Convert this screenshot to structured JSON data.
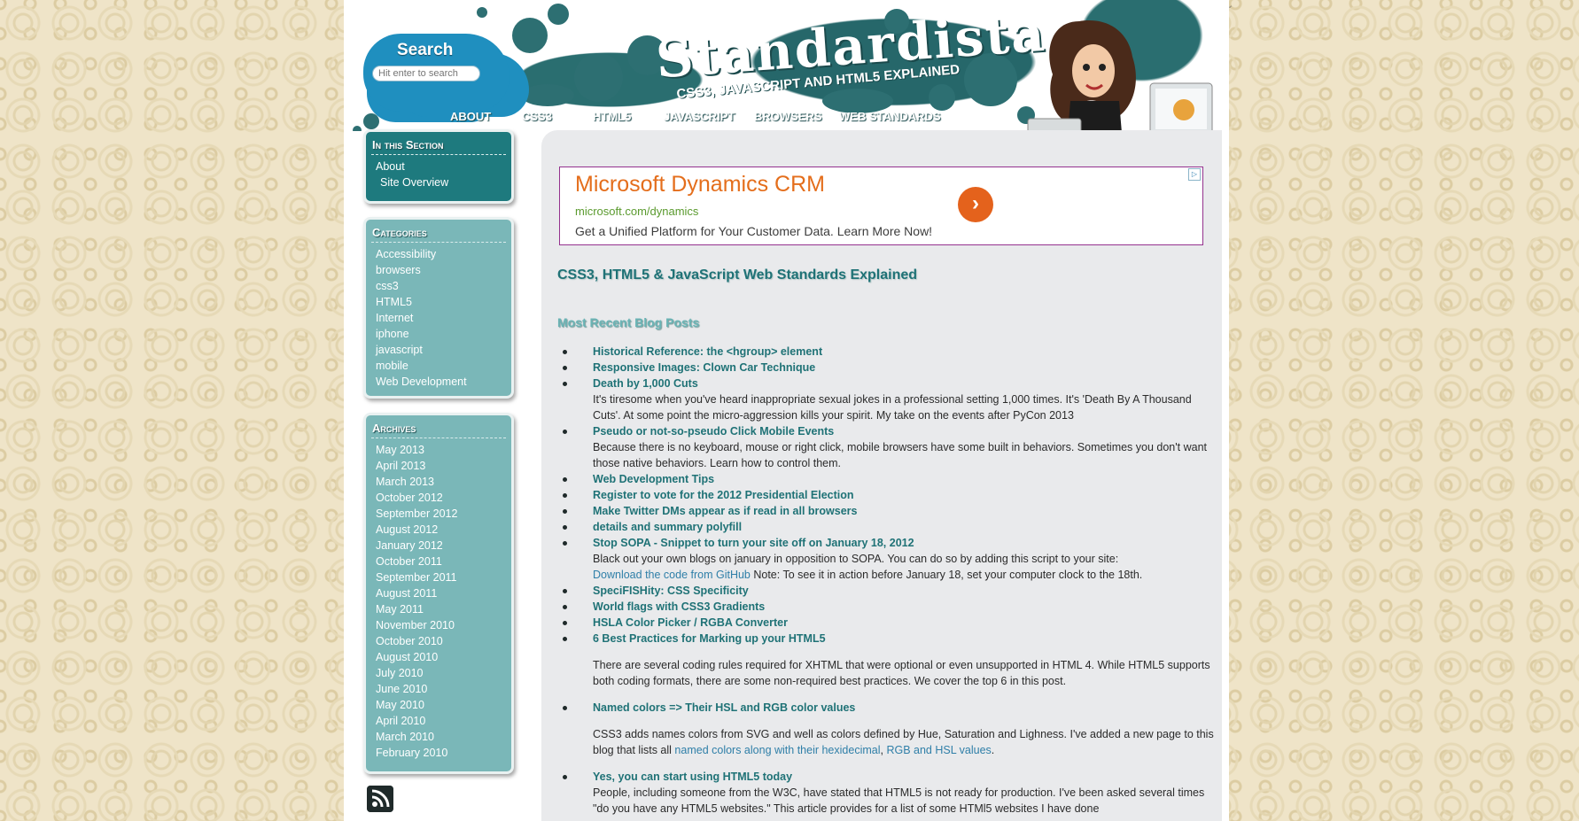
{
  "search": {
    "title": "Search",
    "placeholder": "Hit enter to search"
  },
  "brand": {
    "logo": "Standardista",
    "tagline": "CSS3, JAVASCRIPT AND HTML5 EXPLAINED"
  },
  "nav": [
    {
      "label": "ABOUT"
    },
    {
      "label": "CSS3"
    },
    {
      "label": "HTML5"
    },
    {
      "label": "JAVASCRIPT"
    },
    {
      "label": "BROWSERS"
    },
    {
      "label": "WEB STANDARDS"
    }
  ],
  "sidebar": {
    "section": {
      "heading": "In this Section",
      "items": [
        "About",
        "Site Overview"
      ]
    },
    "categories": {
      "heading": "Categories",
      "items": [
        "Accessibility",
        "browsers",
        "css3",
        "HTML5",
        "Internet",
        "iphone",
        "javascript",
        "mobile",
        "Web Development"
      ]
    },
    "archives": {
      "heading": "Archives",
      "items": [
        "May 2013",
        "April 2013",
        "March 2013",
        "October 2012",
        "September 2012",
        "August 2012",
        "January 2012",
        "October 2011",
        "September 2011",
        "August 2011",
        "May 2011",
        "November 2010",
        "October 2010",
        "August 2010",
        "July 2010",
        "June 2010",
        "May 2010",
        "April 2010",
        "March 2010",
        "February 2010"
      ]
    }
  },
  "ad": {
    "title": "Microsoft Dynamics CRM",
    "url": "microsoft.com/dynamics",
    "description": "Get a Unified Platform for Your Customer Data. Learn More Now!",
    "badge": "▷",
    "button": "›"
  },
  "content": {
    "title": "CSS3, HTML5 & JavaScript Web Standards Explained",
    "recent_heading": "Most Recent Blog Posts",
    "posts": [
      {
        "title": "Historical Reference: the <hgroup> element"
      },
      {
        "title": "Responsive Images: Clown Car Technique"
      },
      {
        "title": "Death by 1,000 Cuts",
        "desc": "It's tiresome when you've heard inappropriate sexual jokes in a professional setting 1,000 times. It's 'Death By A Thousand Cuts'. At some point the micro-aggression kills your spirit. My take on the events after PyCon 2013"
      },
      {
        "title": "Pseudo or not-so-pseudo Click Mobile Events",
        "desc": "Because there is no keyboard, mouse or right click, mobile browsers have some built in behaviors. Sometimes you don't want those native behaviors. Learn how to control them."
      },
      {
        "title": "Web Development Tips"
      },
      {
        "title": "Register to vote for the 2012 Presidential Election"
      },
      {
        "title": "Make Twitter DMs appear as if read in all browsers"
      },
      {
        "title": "details and summary polyfill"
      },
      {
        "title": "Stop SOPA - Snippet to turn your site off on January 18, 2012",
        "desc": "Black out your own blogs on january in opposition to SOPA. You can do so by adding this script to your site:",
        "desc_link": "Download the code from GitHub",
        "desc_after": " Note: To see it in action before January 18, set your computer clock to the 18th."
      },
      {
        "title": "SpeciFISHity: CSS Specificity"
      },
      {
        "title": "World flags with CSS3 Gradients"
      },
      {
        "title": "HSLA Color Picker / RGBA Converter"
      },
      {
        "title": "6 Best Practices for Marking up your HTML5",
        "desc": "There are several coding rules required for XHTML that were optional or even unsupported in HTML 4. While HTML5 supports both coding formats, there are some non-required best practices. We cover the top 6 in this post."
      },
      {
        "title": "Named colors => Their HSL and RGB color values",
        "desc": "CSS3 adds names colors from SVG and well as colors defined by Hue, Saturation and Lighness. I've added a new page to this blog that lists all ",
        "desc_link": "named colors along with their hexidecimal",
        "desc_mid": ", ",
        "desc_link2": "RGB and HSL values",
        "desc_after": "."
      },
      {
        "title": "Yes, you can start using HTML5 today",
        "desc": "People, including someone from the W3C, have stated that HTML5 is not ready for production. I've been asked several times \"do you have any HTML5 websites.\" This article provides for a list of some HTMl5 websites I have done"
      }
    ]
  },
  "colors": {
    "teal_dark": "#1e7a7e",
    "teal_light": "#7ab7b8",
    "link": "#1f7276",
    "ad_border": "#94328e",
    "ad_title": "#e46e1c"
  },
  "icons": [
    "rss-icon",
    "arrow-right-icon",
    "ad-choices-icon"
  ]
}
